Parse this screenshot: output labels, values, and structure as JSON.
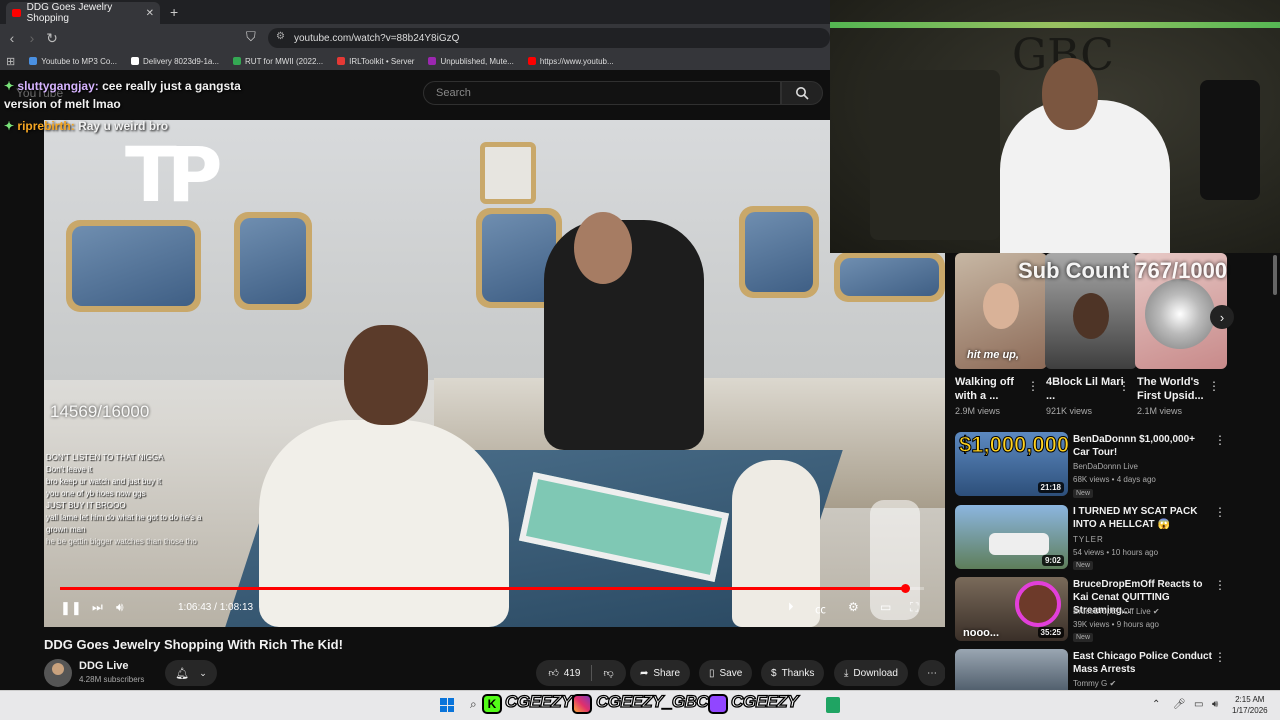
{
  "browser": {
    "tab_title": "DDG Goes Jewelry Shopping",
    "url": "youtube.com/watch?v=88b24Y8iGzQ",
    "bookmarks": [
      {
        "label": "Youtube to MP3 Co...",
        "color": "#4a90e2"
      },
      {
        "label": "Delivery 8023d9-1a...",
        "color": "#ffffff"
      },
      {
        "label": "RUT for MWII (2022...",
        "color": "#34a853"
      },
      {
        "label": "IRLToolkit • Server",
        "color": "#e53935"
      },
      {
        "label": "Unpublished, Mute...",
        "color": "#9c27b0"
      },
      {
        "label": "https://www.youtub...",
        "color": "#ff0000"
      }
    ]
  },
  "youtube": {
    "logo_text": "YouTube",
    "search_placeholder": "Search"
  },
  "overlay_chat": [
    {
      "user": "sluttygangjay:",
      "message": "cee really just a gangsta version of melt lmao",
      "user_color": "#d6b4ff"
    },
    {
      "user": "riprebirth:",
      "message": "Ray u weird bro",
      "user_color": "#f5a623"
    }
  ],
  "video": {
    "channel_watermark": "TP",
    "stream_counter": "14569/16000",
    "time_current": "1:06:43",
    "time_total": "1:08:13",
    "time_display": "1:06:43 / 1:08:13",
    "progress": 0.978,
    "embedded_chat": [
      "DON'T LISTEN TO THAT NIGGA",
      "Don't leave it",
      "bro keep ur watch and just buy it",
      "you one of yb hoes now ggs",
      "JUST BUY IT BROOO",
      "yall lame let him do what he got to do he's a grown man",
      "he be gettin bigger watches than those tho"
    ],
    "title": "DDG Goes Jewelry Shopping With Rich The Kid!",
    "channel": "DDG Live",
    "subscribers": "4.28M subscribers",
    "likes": "419",
    "actions": {
      "share": "Share",
      "save": "Save",
      "thanks": "Thanks",
      "download": "Download"
    }
  },
  "stream_overlay": {
    "sub_count": "Sub Count 767/1000",
    "short_caption": "hit me up,"
  },
  "shorts": [
    {
      "title": "Walking off with a ...",
      "views": "2.9M views"
    },
    {
      "title": "4Block Lil Mari ...",
      "views": "921K views"
    },
    {
      "title": "The World's First Upsid...",
      "views": "2.1M views"
    }
  ],
  "recommended": [
    {
      "title": "BenDaDonnn $1,000,000+ Car Tour!",
      "channel": "BenDaDonnn Live",
      "meta": "68K views • 4 days ago",
      "badge": "New",
      "duration": "21:18",
      "thumb_text": "$1,000,000"
    },
    {
      "title": "I TURNED MY SCAT PACK INTO A HELLCAT 😱",
      "channel": "TYLER",
      "meta": "54 views • 10 hours ago",
      "badge": "New",
      "duration": "9:02",
      "thumb_text": ""
    },
    {
      "title": "BruceDropEmOff Reacts to Kai Cenat QUITTING Streaming...",
      "channel": "BruceDropEmOff Live",
      "meta": "39K views • 9 hours ago",
      "badge": "New",
      "duration": "35:25",
      "thumb_text": "nooo..."
    },
    {
      "title": "East Chicago Police Conduct Mass Arrests",
      "channel": "Tommy G",
      "meta": "",
      "badge": "",
      "duration": "",
      "thumb_text": ""
    }
  ],
  "socials": {
    "kick": "CGEEZY",
    "instagram": "CGEEZY_GBC",
    "twitch": "CGEEZY"
  },
  "taskbar": {
    "time": "2:15 AM",
    "date": "1/17/2026"
  },
  "webcam_sign": "GBC"
}
